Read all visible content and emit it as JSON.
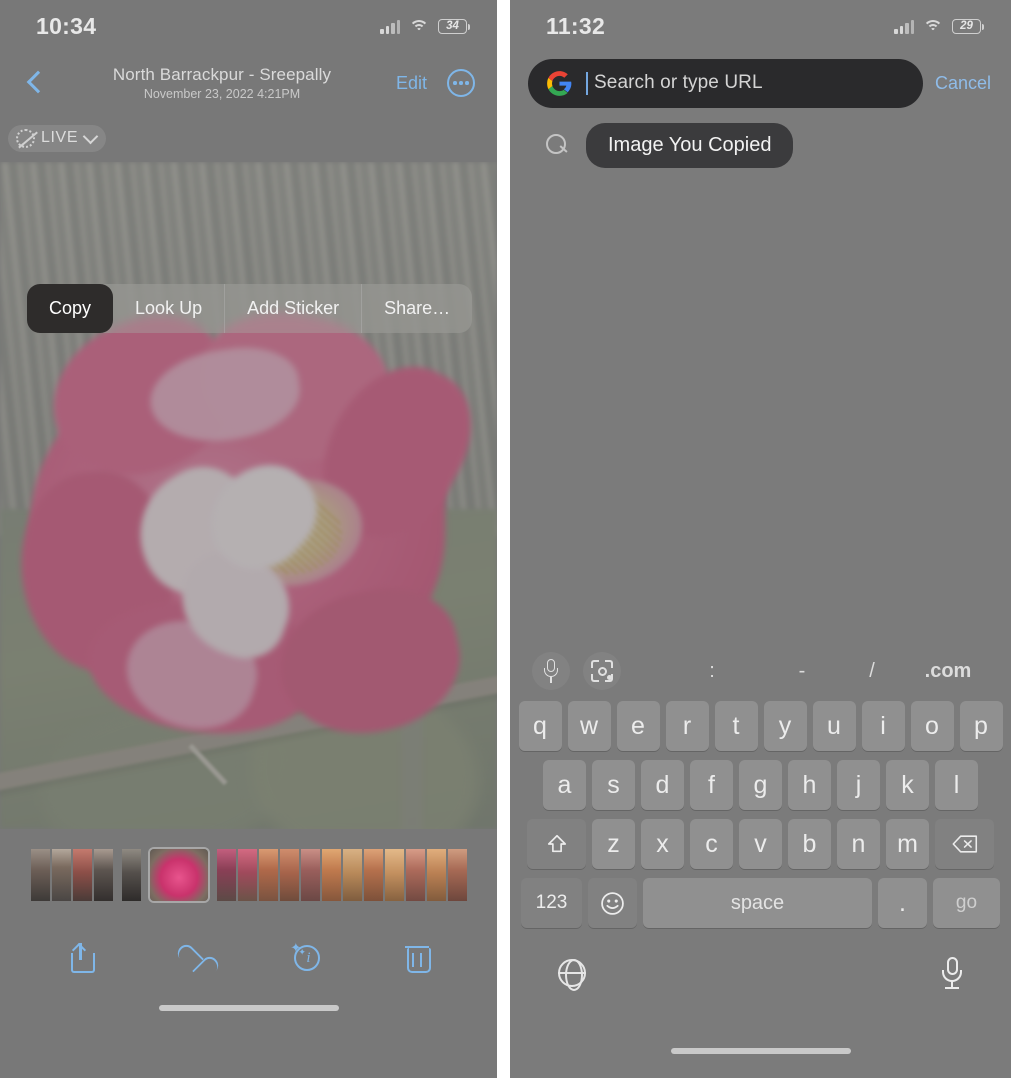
{
  "left_phone": {
    "status_bar": {
      "time": "10:34",
      "battery": "34",
      "signal_icon": "cellular-bars-icon",
      "wifi_icon": "wifi-icon"
    },
    "nav": {
      "back_icon": "chevron-left-icon",
      "title": "North Barrackpur - Sreepally",
      "subtitle": "November 23, 2022  4:21PM",
      "edit_label": "Edit",
      "more_icon": "ellipsis-circle-icon"
    },
    "live_badge": {
      "label": "LIVE",
      "icon": "live-photo-off-icon",
      "chevron": "chevron-down-icon"
    },
    "context_menu": {
      "items": [
        {
          "label": "Copy",
          "selected": true
        },
        {
          "label": "Look Up",
          "selected": false
        },
        {
          "label": "Add Sticker",
          "selected": false
        },
        {
          "label": "Share…",
          "selected": false
        }
      ]
    },
    "toolbar": {
      "share_icon": "share-icon",
      "favorite_icon": "heart-icon",
      "info_icon": "info-sparkle-icon",
      "delete_icon": "trash-icon"
    },
    "filmstrip_label": "photo-thumbnail-strip"
  },
  "right_phone": {
    "status_bar": {
      "time": "11:32",
      "battery": "29",
      "signal_icon": "cellular-bars-icon",
      "wifi_icon": "wifi-icon"
    },
    "omnibox": {
      "engine_icon": "google-g-icon",
      "placeholder": "Search or type URL",
      "value": "",
      "cancel_label": "Cancel"
    },
    "suggestion": {
      "icon": "search-icon",
      "label": "Image You Copied"
    },
    "keyboard": {
      "accessory": {
        "mic_icon": "microphone-icon",
        "lens_icon": "google-lens-icon",
        "shortcuts": [
          ":",
          "-",
          "/",
          ".com"
        ]
      },
      "row1": [
        "q",
        "w",
        "e",
        "r",
        "t",
        "y",
        "u",
        "i",
        "o",
        "p"
      ],
      "row2": [
        "a",
        "s",
        "d",
        "f",
        "g",
        "h",
        "j",
        "k",
        "l"
      ],
      "row3": [
        "z",
        "x",
        "c",
        "v",
        "b",
        "n",
        "m"
      ],
      "shift_icon": "shift-icon",
      "backspace_icon": "backspace-icon",
      "numbers_label": "123",
      "emoji_icon": "emoji-icon",
      "space_label": "space",
      "period_label": ".",
      "go_label": "go",
      "globe_icon": "globe-icon",
      "dictation_icon": "microphone-icon"
    }
  },
  "colors": {
    "ios_blue": "#7fb6e8",
    "chrome_blue": "#8fbce9",
    "pill_dark": "#3b3b3d",
    "omnibox_dark": "#2a2a2c",
    "selected_menu": "#2e2c2b"
  }
}
